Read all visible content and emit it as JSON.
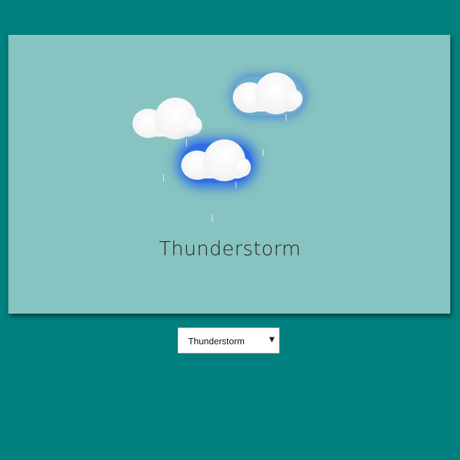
{
  "page": {
    "background": "#007f7f",
    "scene_background": "#87c3c1"
  },
  "weather": {
    "condition": "Thunderstorm",
    "lightning_glow_color": "#2f6fe6",
    "cloud_color": "#f5f5f5",
    "rain_color": "#ffffff",
    "clouds": [
      {
        "icon": "cloud-icon",
        "glowing": false
      },
      {
        "icon": "cloud-icon",
        "glowing": true,
        "glow_strength": "soft"
      },
      {
        "icon": "cloud-icon",
        "glowing": true,
        "glow_strength": "strong"
      }
    ]
  },
  "selector": {
    "selected_value": "Thunderstorm",
    "arrow_icon": "▼"
  }
}
